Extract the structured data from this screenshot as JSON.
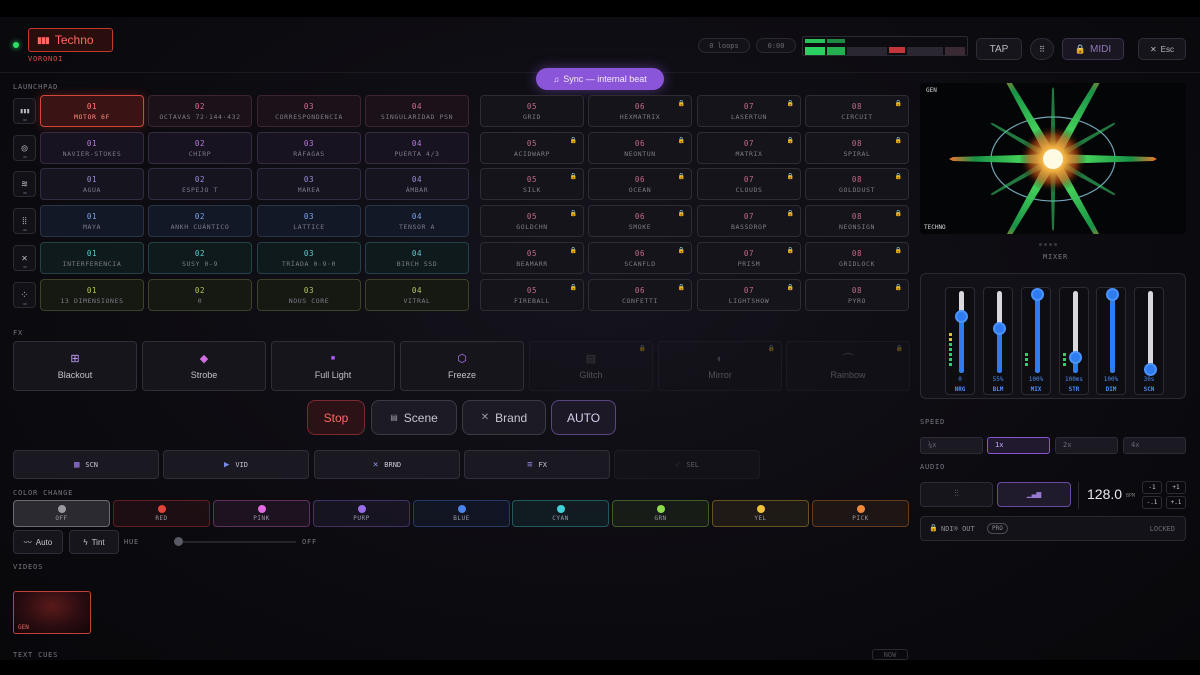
{
  "app": {
    "genre": "Techno",
    "engine": "VORONOI"
  },
  "topbar": {
    "loops": "0 loops",
    "time": "0:00",
    "tap": "TAP",
    "midi": "MIDI",
    "esc": "Esc"
  },
  "sync_label": "Sync — internal beat",
  "sections": {
    "launchpad": "LAUNCHPAD",
    "fx": "FX",
    "color_change": "COLOR CHANGE",
    "videos": "VIDEOS",
    "text_cues": "TEXT CUES",
    "mixer": "MIXER",
    "speed": "SPEED",
    "audio": "AUDIO"
  },
  "launchpad_rows": [
    {
      "icon": "bars-icon",
      "pads": [
        [
          "01",
          "MOTOR 6F"
        ],
        [
          "02",
          "OCTAVAS 72·144·432"
        ],
        [
          "03",
          "CORRESPONDENCIA"
        ],
        [
          "04",
          "SINGULARIDAD PSN"
        ]
      ]
    },
    {
      "icon": "spiral-icon",
      "pads": [
        [
          "01",
          "NAVIER-STOKES"
        ],
        [
          "02",
          "CHIRP"
        ],
        [
          "03",
          "RÁFAGAS"
        ],
        [
          "04",
          "PUERTA 4/3"
        ]
      ]
    },
    {
      "icon": "waves-icon",
      "pads": [
        [
          "01",
          "AGUA"
        ],
        [
          "02",
          "ESPEJO T"
        ],
        [
          "03",
          "MAREA"
        ],
        [
          "04",
          "ÁMBAR"
        ]
      ]
    },
    {
      "icon": "waveform-icon",
      "pads": [
        [
          "01",
          "MAYA"
        ],
        [
          "02",
          "ANKH CUÁNTICO"
        ],
        [
          "03",
          "LATTICE"
        ],
        [
          "04",
          "TENSOR A"
        ]
      ]
    },
    {
      "icon": "cross-icon",
      "pads": [
        [
          "01",
          "INTERFERENCIA"
        ],
        [
          "02",
          "SUSY 0-9"
        ],
        [
          "03",
          "TRÍADA 0·9·0"
        ],
        [
          "04",
          "BIRCH SSD"
        ]
      ]
    },
    {
      "icon": "dots-circle-icon",
      "pads": [
        [
          "01",
          "13 DIMENSIONES"
        ],
        [
          "02",
          "0"
        ],
        [
          "03",
          "NOUS CORE"
        ],
        [
          "04",
          "VITRAL"
        ]
      ]
    }
  ],
  "launchpad_right": [
    [
      [
        "05",
        "GRID"
      ],
      [
        "06",
        "HEXMATRIX"
      ],
      [
        "07",
        "LASERTUN"
      ],
      [
        "08",
        "CIRCUIT"
      ]
    ],
    [
      [
        "05",
        "ACIDWARP"
      ],
      [
        "06",
        "NEONTUN"
      ],
      [
        "07",
        "MATRIX"
      ],
      [
        "08",
        "SPIRAL"
      ]
    ],
    [
      [
        "05",
        "SILK"
      ],
      [
        "06",
        "OCEAN"
      ],
      [
        "07",
        "CLOUDS"
      ],
      [
        "08",
        "GOLDDUST"
      ]
    ],
    [
      [
        "05",
        "GOLDCHN"
      ],
      [
        "06",
        "SMOKE"
      ],
      [
        "07",
        "BASSDROP"
      ],
      [
        "08",
        "NEONSIGN"
      ]
    ],
    [
      [
        "05",
        "BEAMARR"
      ],
      [
        "06",
        "SCANFLD"
      ],
      [
        "07",
        "PRISM"
      ],
      [
        "08",
        "GRIDLOCK"
      ]
    ],
    [
      [
        "05",
        "FIREBALL"
      ],
      [
        "06",
        "CONFETTI"
      ],
      [
        "07",
        "LIGHTSHOW"
      ],
      [
        "08",
        "PYRO"
      ]
    ]
  ],
  "fx_buttons": [
    "Blackout",
    "Strobe",
    "Full Light",
    "Freeze",
    "Glitch",
    "Mirror",
    "Rainbow"
  ],
  "mode_buttons": {
    "stop": "Stop",
    "scene": "Scene",
    "brand": "Brand",
    "auto": "AUTO"
  },
  "wide_buttons": [
    "SCN",
    "VID",
    "BRND",
    "FX",
    "SEL"
  ],
  "color_buttons": [
    {
      "label": "OFF",
      "color": "#9a9aa0"
    },
    {
      "label": "RED",
      "color": "#e0443b"
    },
    {
      "label": "PINK",
      "color": "#e06adf"
    },
    {
      "label": "PURP",
      "color": "#9a6ee8"
    },
    {
      "label": "BLUE",
      "color": "#4a84e8"
    },
    {
      "label": "CYAN",
      "color": "#3fd2d8"
    },
    {
      "label": "GRN",
      "color": "#8fdc4a"
    },
    {
      "label": "YEL",
      "color": "#f0c23a"
    },
    {
      "label": "PICK",
      "color": "#f08a3a"
    }
  ],
  "color_controls": {
    "auto": "Auto",
    "tint": "Tint",
    "hue": "HUE",
    "hue_value": "OFF"
  },
  "video_thumb_label": "GEN",
  "text_cue_button": "NOW",
  "preview": {
    "top_label": "GEN",
    "bottom_label": "TECHNO"
  },
  "mixer_channels": [
    {
      "name": "NRG",
      "value": "0",
      "level": 0.7
    },
    {
      "name": "BLM",
      "value": "55%",
      "level": 0.55
    },
    {
      "name": "MIX",
      "value": "100%",
      "level": 1.0
    },
    {
      "name": "STR",
      "value": "100ms",
      "level": 0.2
    },
    {
      "name": "DIM",
      "value": "100%",
      "level": 1.0
    },
    {
      "name": "SCN",
      "value": "30s",
      "level": 0.05
    }
  ],
  "speed_options": [
    "¼x",
    "1x",
    "2x",
    "4x"
  ],
  "speed_selected": "1x",
  "audio": {
    "bpm_value": "128.0",
    "bpm_unit": "BPM",
    "minus1": "-1",
    "plus1": "+1",
    "minus_small": "-.1",
    "plus_small": "+.1",
    "ndi_label": "NDI® OUT",
    "ndi_badge": "PRO",
    "ndi_state": "LOCKED"
  }
}
